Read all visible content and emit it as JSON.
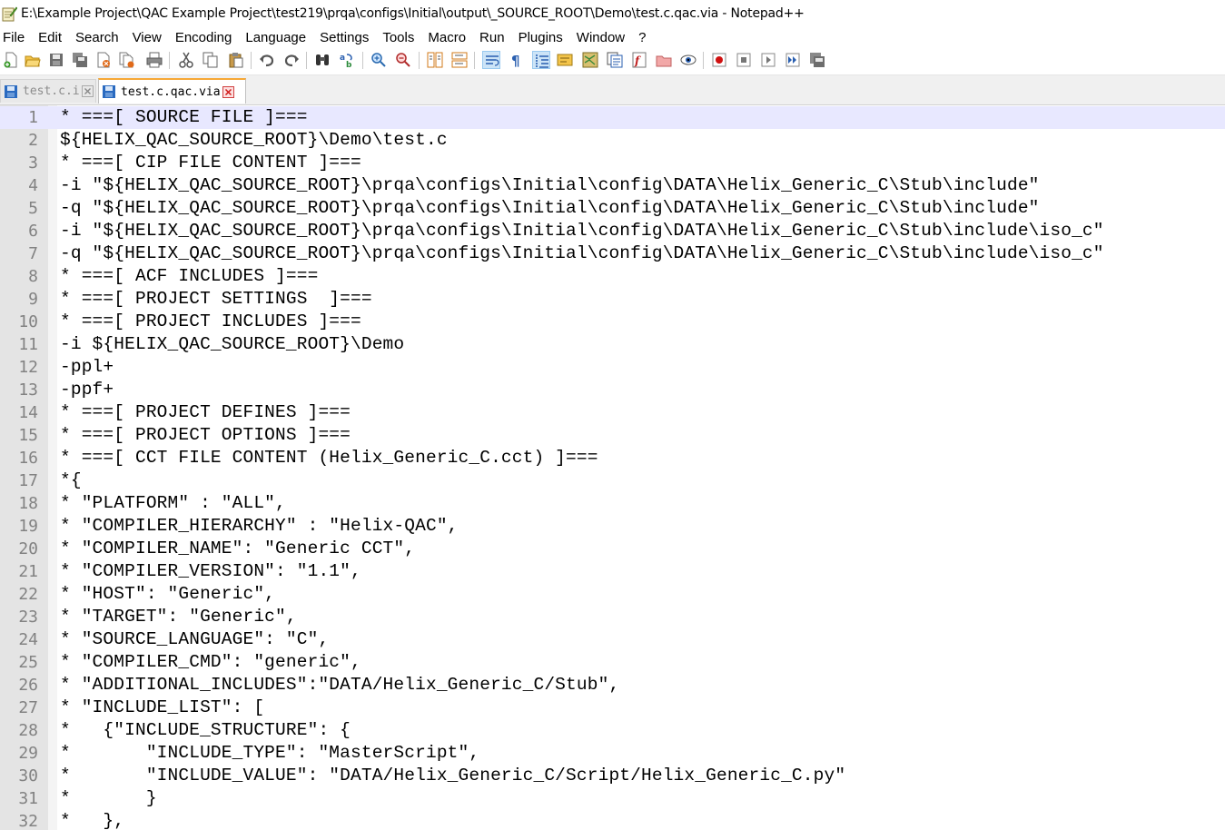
{
  "window": {
    "title": "E:\\Example Project\\QAC Example Project\\test219\\prqa\\configs\\Initial\\output\\_SOURCE_ROOT\\Demo\\test.c.qac.via - Notepad++"
  },
  "menu": {
    "items": [
      "File",
      "Edit",
      "Search",
      "View",
      "Encoding",
      "Language",
      "Settings",
      "Tools",
      "Macro",
      "Run",
      "Plugins",
      "Window",
      "?"
    ]
  },
  "tabs": [
    {
      "label": "test.c.i",
      "active": false
    },
    {
      "label": "test.c.qac.via",
      "active": true
    }
  ],
  "editor": {
    "current_line": 1,
    "lines": [
      "* ===[ SOURCE FILE ]===",
      "${HELIX_QAC_SOURCE_ROOT}\\Demo\\test.c",
      "* ===[ CIP FILE CONTENT ]===",
      "-i \"${HELIX_QAC_SOURCE_ROOT}\\prqa\\configs\\Initial\\config\\DATA\\Helix_Generic_C\\Stub\\include\"",
      "-q \"${HELIX_QAC_SOURCE_ROOT}\\prqa\\configs\\Initial\\config\\DATA\\Helix_Generic_C\\Stub\\include\"",
      "-i \"${HELIX_QAC_SOURCE_ROOT}\\prqa\\configs\\Initial\\config\\DATA\\Helix_Generic_C\\Stub\\include\\iso_c\"",
      "-q \"${HELIX_QAC_SOURCE_ROOT}\\prqa\\configs\\Initial\\config\\DATA\\Helix_Generic_C\\Stub\\include\\iso_c\"",
      "* ===[ ACF INCLUDES ]===",
      "* ===[ PROJECT SETTINGS  ]===",
      "* ===[ PROJECT INCLUDES ]===",
      "-i ${HELIX_QAC_SOURCE_ROOT}\\Demo",
      "-ppl+",
      "-ppf+",
      "* ===[ PROJECT DEFINES ]===",
      "* ===[ PROJECT OPTIONS ]===",
      "* ===[ CCT FILE CONTENT (Helix_Generic_C.cct) ]===",
      "*{",
      "* \"PLATFORM\" : \"ALL\",",
      "* \"COMPILER_HIERARCHY\" : \"Helix-QAC\",",
      "* \"COMPILER_NAME\": \"Generic CCT\",",
      "* \"COMPILER_VERSION\": \"1.1\",",
      "* \"HOST\": \"Generic\",",
      "* \"TARGET\": \"Generic\",",
      "* \"SOURCE_LANGUAGE\": \"C\",",
      "* \"COMPILER_CMD\": \"generic\",",
      "* \"ADDITIONAL_INCLUDES\":\"DATA/Helix_Generic_C/Stub\",",
      "* \"INCLUDE_LIST\": [",
      "*   {\"INCLUDE_STRUCTURE\": {",
      "*       \"INCLUDE_TYPE\": \"MasterScript\",",
      "*       \"INCLUDE_VALUE\": \"DATA/Helix_Generic_C/Script/Helix_Generic_C.py\"",
      "*       }",
      "*   },"
    ]
  }
}
